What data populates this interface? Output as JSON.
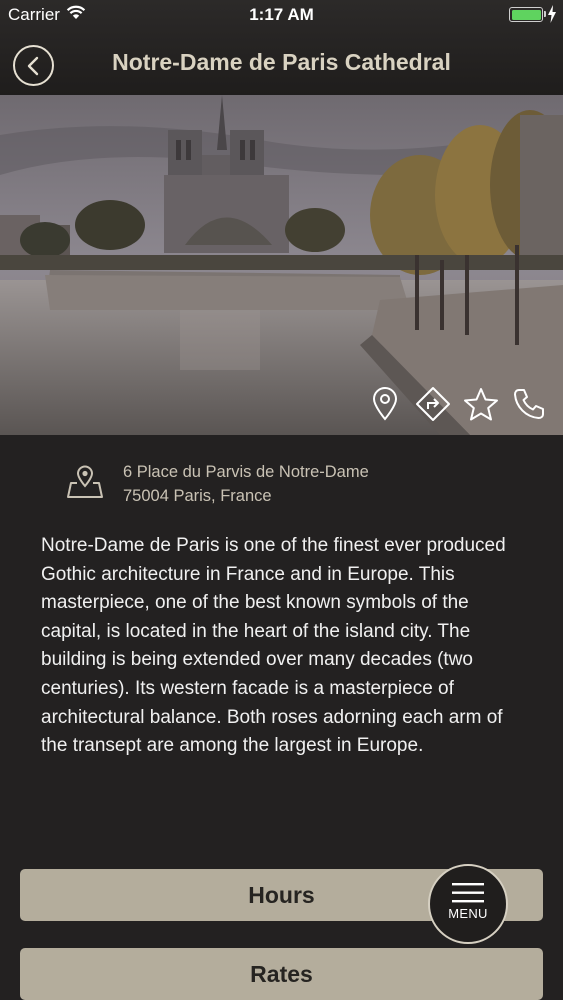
{
  "status_bar": {
    "carrier": "Carrier",
    "time": "1:17 AM",
    "battery_color": "#5fd35f"
  },
  "header": {
    "back_icon": "chevron-left-circle-icon",
    "title": "Notre-Dame de Paris Cathedral"
  },
  "photo": {
    "actions": [
      {
        "icon": "map-pin-icon"
      },
      {
        "icon": "directions-icon"
      },
      {
        "icon": "star-icon"
      },
      {
        "icon": "phone-icon"
      }
    ]
  },
  "address": {
    "icon": "map-location-icon",
    "line1": "6 Place du Parvis de Notre-Dame",
    "line2": "75004 Paris, France"
  },
  "description": "Notre-Dame de Paris is one of the finest ever produced Gothic architecture in France and in Europe. This masterpiece, one of the best known symbols of the capital, is located in the heart of the island city. The building is being extended over many decades (two centuries). Its western facade is a masterpiece of architectural balance. Both roses adorning each arm of the transept are among the largest in Europe.",
  "buttons": {
    "hours": "Hours",
    "rates": "Rates"
  },
  "menu": {
    "icon": "hamburger-icon",
    "label": "MENU"
  },
  "colors": {
    "background": "#232121",
    "title": "#d9d2c1",
    "button": "#b4ad9c",
    "button_text": "#262421"
  }
}
